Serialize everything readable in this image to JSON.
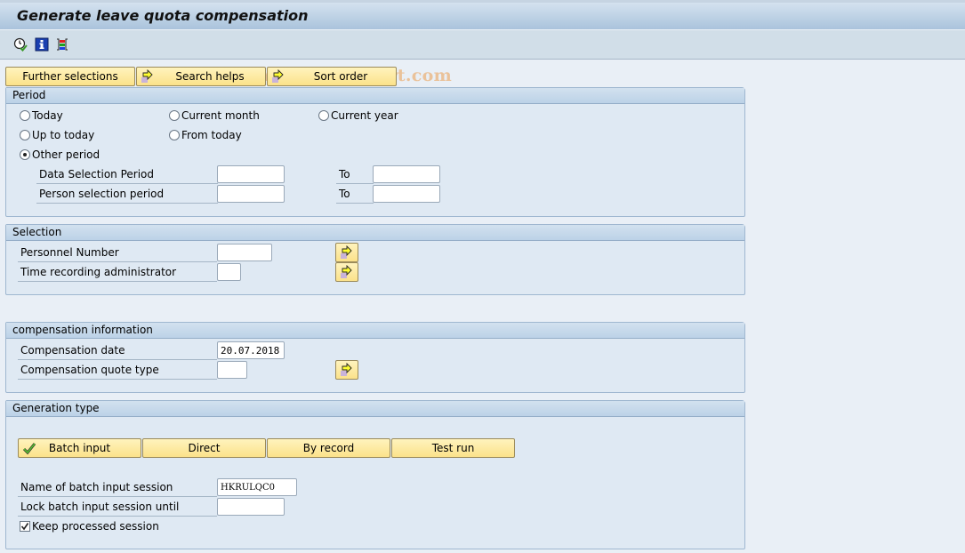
{
  "window": {
    "title": "Generate leave quota compensation"
  },
  "toolbar": {
    "icons": [
      "execute-icon",
      "info-icon",
      "selection-options-icon"
    ],
    "watermark": "© www.tutorialkart.com"
  },
  "top_buttons": {
    "further_selections": "Further selections",
    "search_helps": "Search helps",
    "sort_order": "Sort order"
  },
  "period": {
    "title": "Period",
    "radios": {
      "today": "Today",
      "current_month": "Current month",
      "current_year": "Current year",
      "up_to_today": "Up to today",
      "from_today": "From today",
      "other_period": "Other period"
    },
    "selected": "other_period",
    "data_selection_label": "Data Selection Period",
    "data_selection_from": "",
    "data_selection_to": "",
    "person_selection_label": "Person selection period",
    "person_selection_from": "",
    "person_selection_to": "",
    "to_label": "To"
  },
  "selection": {
    "title": "Selection",
    "personnel_number_label": "Personnel Number",
    "personnel_number_value": "",
    "time_admin_label": "Time recording administrator",
    "time_admin_value": ""
  },
  "compensation": {
    "title": "compensation information",
    "date_label": "Compensation date",
    "date_value": "20.07.2018",
    "quota_type_label": "Compensation quote type",
    "quota_type_value": ""
  },
  "generation": {
    "title": "Generation type",
    "buttons": {
      "batch_input": "Batch input",
      "direct": "Direct",
      "by_record": "By record",
      "test_run": "Test run"
    },
    "selected": "batch_input",
    "session_name_label": "Name of batch input session",
    "session_name_value": "HKRULQC0",
    "lock_until_label": "Lock batch input session until",
    "lock_until_value": "",
    "keep_processed_label": "Keep processed session",
    "keep_processed_checked": true
  }
}
